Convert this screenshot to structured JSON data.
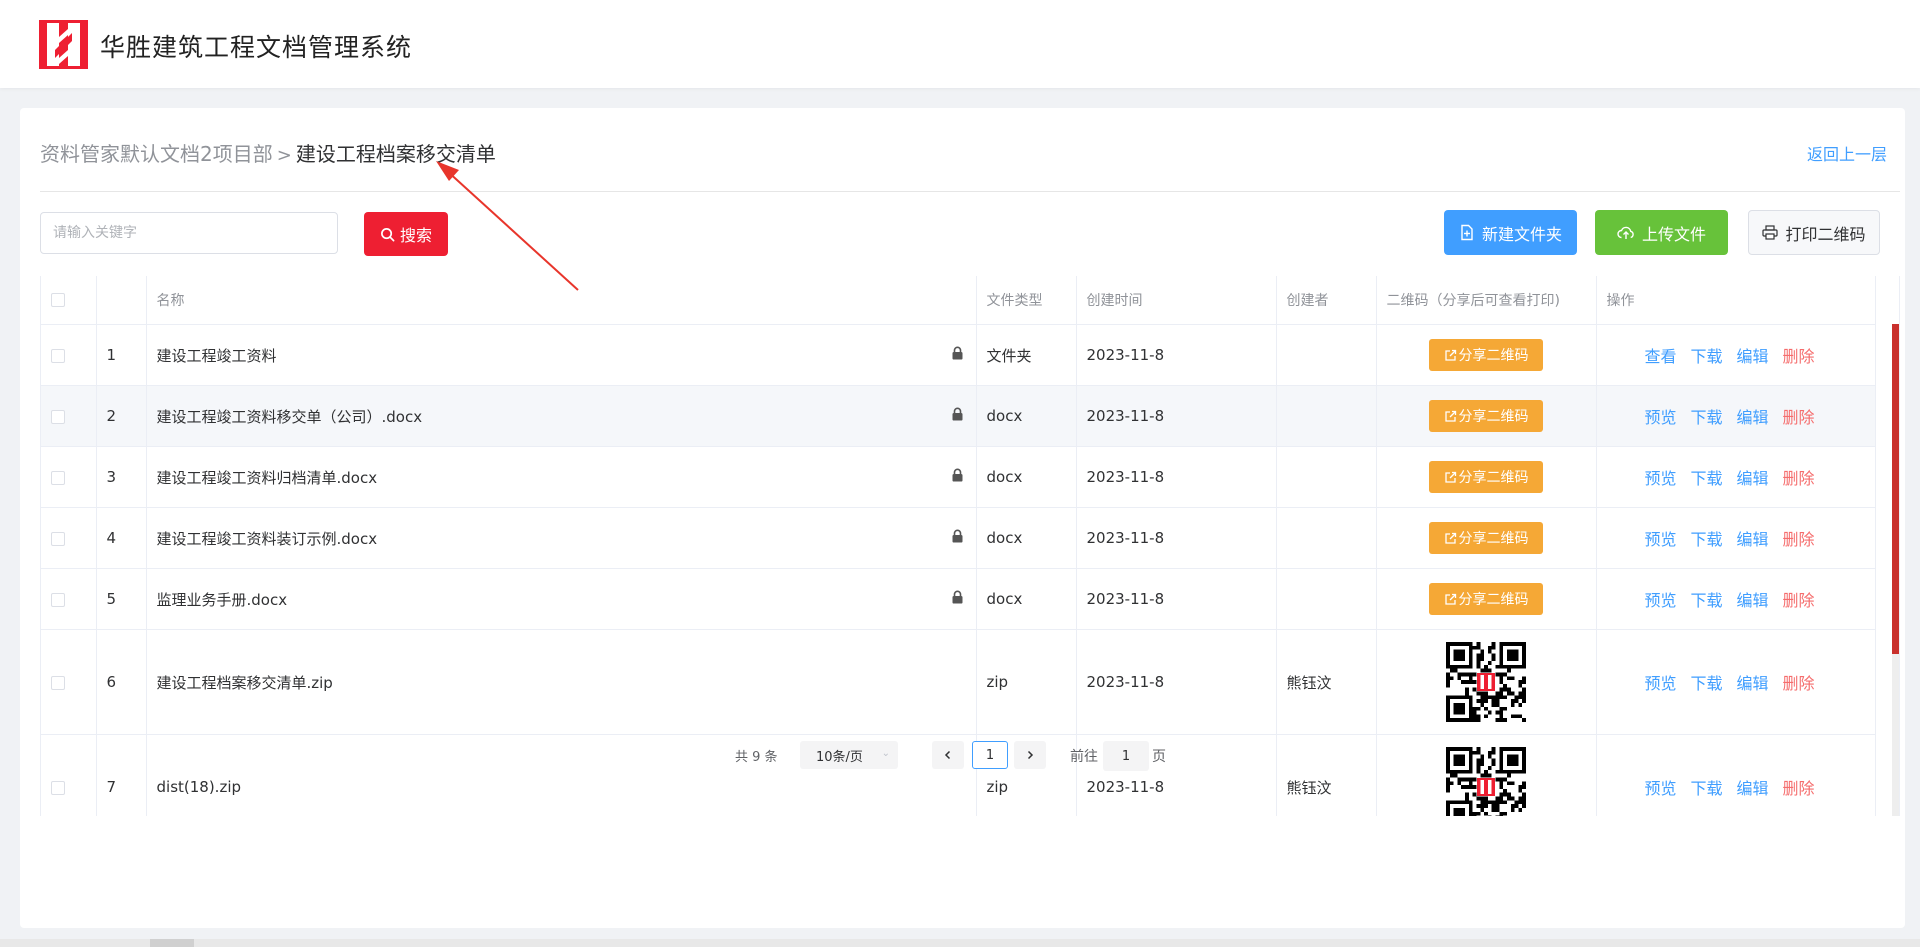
{
  "app": {
    "title": "华胜建筑工程文档管理系统",
    "brand_color": "#ee1f32"
  },
  "breadcrumb": {
    "parent": "资料管家默认文档2项目部",
    "separator": ">",
    "current": "建设工程档案移交清单"
  },
  "back_link": "返回上一层",
  "search": {
    "placeholder": "请输入关键字",
    "value": "",
    "button_label": "搜索"
  },
  "toolbar": {
    "new_folder": "新建文件夹",
    "upload": "上传文件",
    "print_qr": "打印二维码"
  },
  "table": {
    "columns": [
      "名称",
      "文件类型",
      "创建时间",
      "创建者",
      "二维码（分享后可查看打印)",
      "操作"
    ],
    "share_label": "分享二维码",
    "rows": [
      {
        "index": "1",
        "name": "建设工程竣工资料",
        "locked": true,
        "type": "文件夹",
        "created": "2023-11-8",
        "creator": "",
        "qr": "share",
        "ops": [
          "查看",
          "下载",
          "编辑",
          "删除"
        ]
      },
      {
        "index": "2",
        "name": "建设工程竣工资料移交单（公司）.docx",
        "locked": true,
        "type": "docx",
        "created": "2023-11-8",
        "creator": "",
        "qr": "share",
        "ops": [
          "预览",
          "下载",
          "编辑",
          "删除"
        ]
      },
      {
        "index": "3",
        "name": "建设工程竣工资料归档清单.docx",
        "locked": true,
        "type": "docx",
        "created": "2023-11-8",
        "creator": "",
        "qr": "share",
        "ops": [
          "预览",
          "下载",
          "编辑",
          "删除"
        ]
      },
      {
        "index": "4",
        "name": "建设工程竣工资料装订示例.docx",
        "locked": true,
        "type": "docx",
        "created": "2023-11-8",
        "creator": "",
        "qr": "share",
        "ops": [
          "预览",
          "下载",
          "编辑",
          "删除"
        ]
      },
      {
        "index": "5",
        "name": "监理业务手册.docx",
        "locked": true,
        "type": "docx",
        "created": "2023-11-8",
        "creator": "",
        "qr": "share",
        "ops": [
          "预览",
          "下载",
          "编辑",
          "删除"
        ]
      },
      {
        "index": "6",
        "name": "建设工程档案移交清单.zip",
        "locked": false,
        "type": "zip",
        "created": "2023-11-8",
        "creator": "熊钰汶",
        "qr": "image",
        "ops": [
          "预览",
          "下载",
          "编辑",
          "删除"
        ]
      },
      {
        "index": "7",
        "name": "dist(18).zip",
        "locked": false,
        "type": "zip",
        "created": "2023-11-8",
        "creator": "熊钰汶",
        "qr": "image",
        "ops": [
          "预览",
          "下载",
          "编辑",
          "删除"
        ]
      }
    ]
  },
  "pagination": {
    "total_label": "共 9 条",
    "page_size": "10条/页",
    "current_page": "1",
    "goto_prefix": "前往",
    "goto_value": "1",
    "goto_suffix": "页"
  },
  "icons": {
    "search": "search-icon",
    "new_folder": "folder-add-icon",
    "upload": "upload-icon",
    "print": "printer-icon",
    "lock": "lock-icon",
    "share": "share-icon",
    "prev": "chevron-left-icon",
    "next": "chevron-right-icon"
  },
  "colors": {
    "primary": "#409eff",
    "success": "#67c23a",
    "warning": "#f5a836",
    "danger": "#f56c6c",
    "annotation": "#e8352b"
  }
}
